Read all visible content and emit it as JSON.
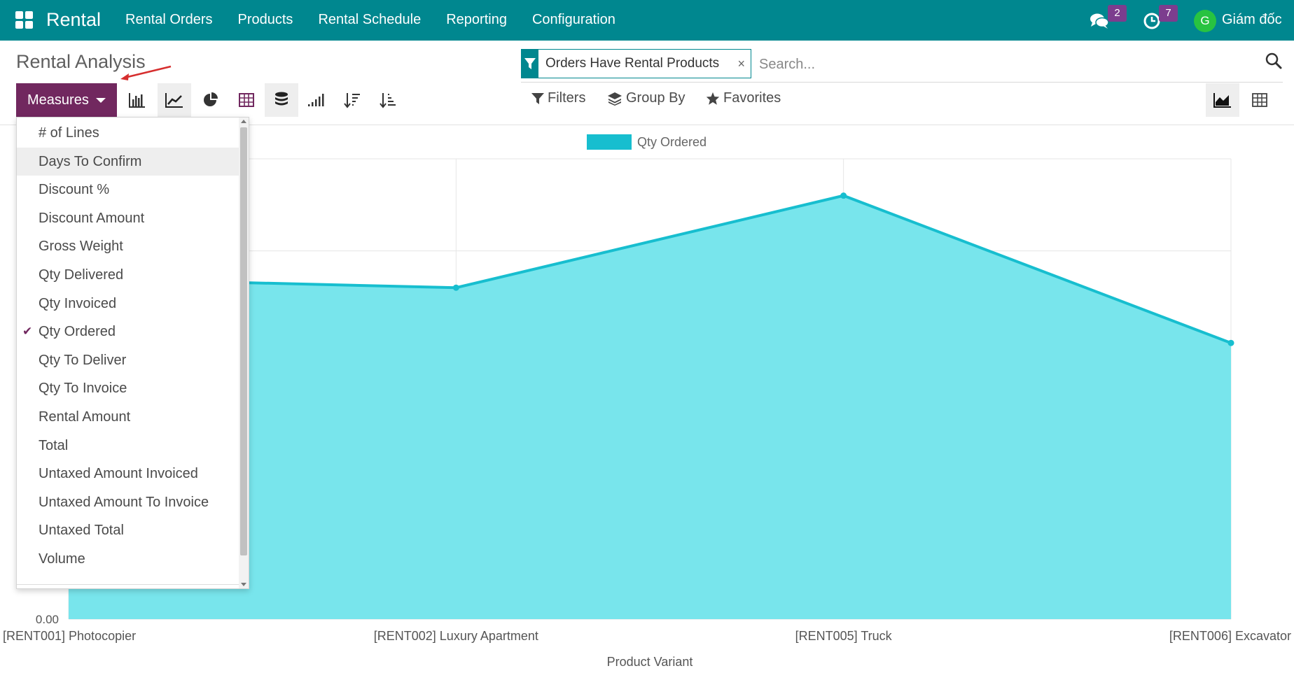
{
  "navbar": {
    "app_name": "Rental",
    "menu": [
      "Rental Orders",
      "Products",
      "Rental Schedule",
      "Reporting",
      "Configuration"
    ],
    "messages_count": "2",
    "activities_count": "7",
    "user_initial": "G",
    "user_name": "Giám đốc",
    "bg_color": "#00878f"
  },
  "control_panel": {
    "title": "Rental Analysis",
    "search": {
      "facet_label": "Orders Have Rental Products",
      "facet_remove": "×",
      "placeholder": "Search..."
    },
    "measures_label": "Measures",
    "filters_label": "Filters",
    "group_by_label": "Group By",
    "favorites_label": "Favorites",
    "accent_color": "#71285f"
  },
  "measures_menu": {
    "items": [
      {
        "label": "# of Lines",
        "checked": false
      },
      {
        "label": "Days To Confirm",
        "checked": false
      },
      {
        "label": "Discount %",
        "checked": false
      },
      {
        "label": "Discount Amount",
        "checked": false
      },
      {
        "label": "Gross Weight",
        "checked": false
      },
      {
        "label": "Qty Delivered",
        "checked": false
      },
      {
        "label": "Qty Invoiced",
        "checked": false
      },
      {
        "label": "Qty Ordered",
        "checked": true
      },
      {
        "label": "Qty To Deliver",
        "checked": false
      },
      {
        "label": "Qty To Invoice",
        "checked": false
      },
      {
        "label": "Rental Amount",
        "checked": false
      },
      {
        "label": "Total",
        "checked": false
      },
      {
        "label": "Untaxed Amount Invoiced",
        "checked": false
      },
      {
        "label": "Untaxed Amount To Invoice",
        "checked": false
      },
      {
        "label": "Untaxed Total",
        "checked": false
      },
      {
        "label": "Volume",
        "checked": false
      }
    ],
    "hovered": "Days To Confirm"
  },
  "chart_data": {
    "type": "area",
    "categories": [
      "[RENT001] Photocopier",
      "[RENT002] Luxury Apartment",
      "[RENT005] Truck",
      "[RENT006] Excavator"
    ],
    "series": [
      {
        "name": "Qty Ordered",
        "values": [
          3.7,
          3.6,
          4.6,
          3.0
        ],
        "color": "#17becf",
        "fill": "#78e5ec"
      }
    ],
    "xlabel": "Product Variant",
    "ylabel": "",
    "ylim": [
      0,
      5
    ],
    "y_tick_visible": "0.00",
    "grid": true,
    "legend": "top-center"
  }
}
